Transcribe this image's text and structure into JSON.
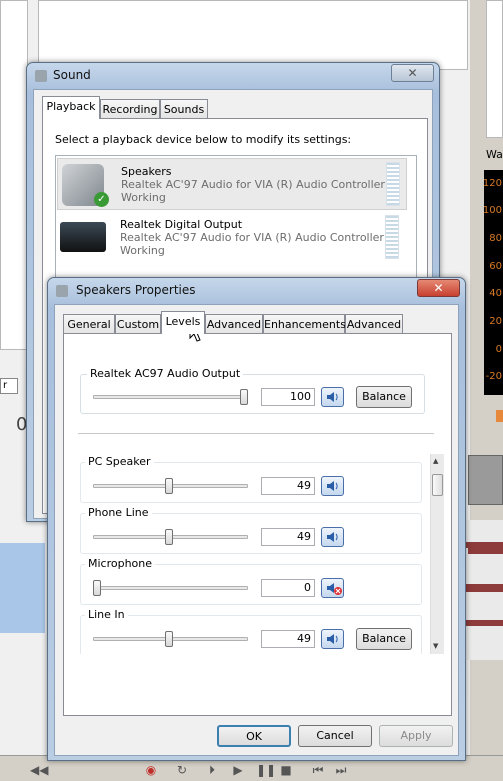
{
  "sound": {
    "title": "Sound",
    "tabs": [
      "Playback",
      "Recording",
      "Sounds"
    ],
    "instruction": "Select a playback device below to modify its settings:",
    "devices": [
      {
        "name": "Speakers",
        "line1": "Realtek AC'97 Audio for VIA (R) Audio Controller",
        "line2": "Working"
      },
      {
        "name": "Realtek Digital Output",
        "line1": "Realtek AC'97 Audio for VIA (R) Audio Controller",
        "line2": "Working"
      }
    ]
  },
  "props": {
    "title": "Speakers Properties",
    "tabs": [
      "General",
      "Custom",
      "Levels",
      "Advanced",
      "Enhancements",
      "Advanced"
    ],
    "master": {
      "label": "Realtek AC97 Audio Output",
      "value": "100",
      "level": 1.0,
      "balance": "Balance"
    },
    "channels": [
      {
        "label": "PC Speaker",
        "value": "49",
        "level": 0.49,
        "muted": false
      },
      {
        "label": "Phone Line",
        "value": "49",
        "level": 0.49,
        "muted": false
      },
      {
        "label": "Microphone",
        "value": "0",
        "level": 0.0,
        "muted": true
      },
      {
        "label": "Line In",
        "value": "49",
        "level": 0.49,
        "muted": false,
        "balance": "Balance"
      }
    ],
    "buttons": {
      "ok": "OK",
      "cancel": "Cancel",
      "apply": "Apply"
    }
  },
  "background": {
    "wa_label": "Wa",
    "meter_ticks": [
      "120",
      "100",
      "80",
      "60",
      "40",
      "20",
      "0",
      "-20"
    ],
    "left_char": "0"
  },
  "colors": {
    "accent": "#3c7fb1",
    "meter_text": "#d87a26",
    "wave": "#8d3b3b",
    "close": "#c8402f"
  }
}
